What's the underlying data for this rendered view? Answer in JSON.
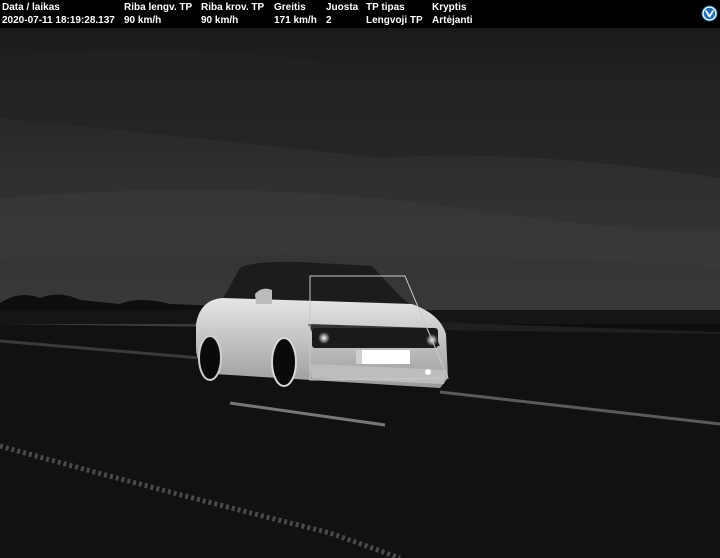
{
  "header": {
    "columns": [
      {
        "label": "Data / laikas",
        "value": "2020-07-11 18:19:28.137"
      },
      {
        "label": "Riba lengv. TP",
        "value": "90 km/h"
      },
      {
        "label": "Riba krov. TP",
        "value": "90 km/h"
      },
      {
        "label": "Greitis",
        "value": "171 km/h"
      },
      {
        "label": "Juosta",
        "value": "2"
      },
      {
        "label": "TP tipas",
        "value": "Lengvoji TP"
      },
      {
        "label": "Kryptis",
        "value": "Artėjanti"
      }
    ],
    "logo_icon": "camera-system-logo-icon"
  },
  "photo": {
    "scene": "night-highway-speed-camera-capture",
    "colors": {
      "sky": "#2a2a2a",
      "road": "#111111",
      "car": "#d8d8d8",
      "plate": "#ffffff"
    }
  }
}
